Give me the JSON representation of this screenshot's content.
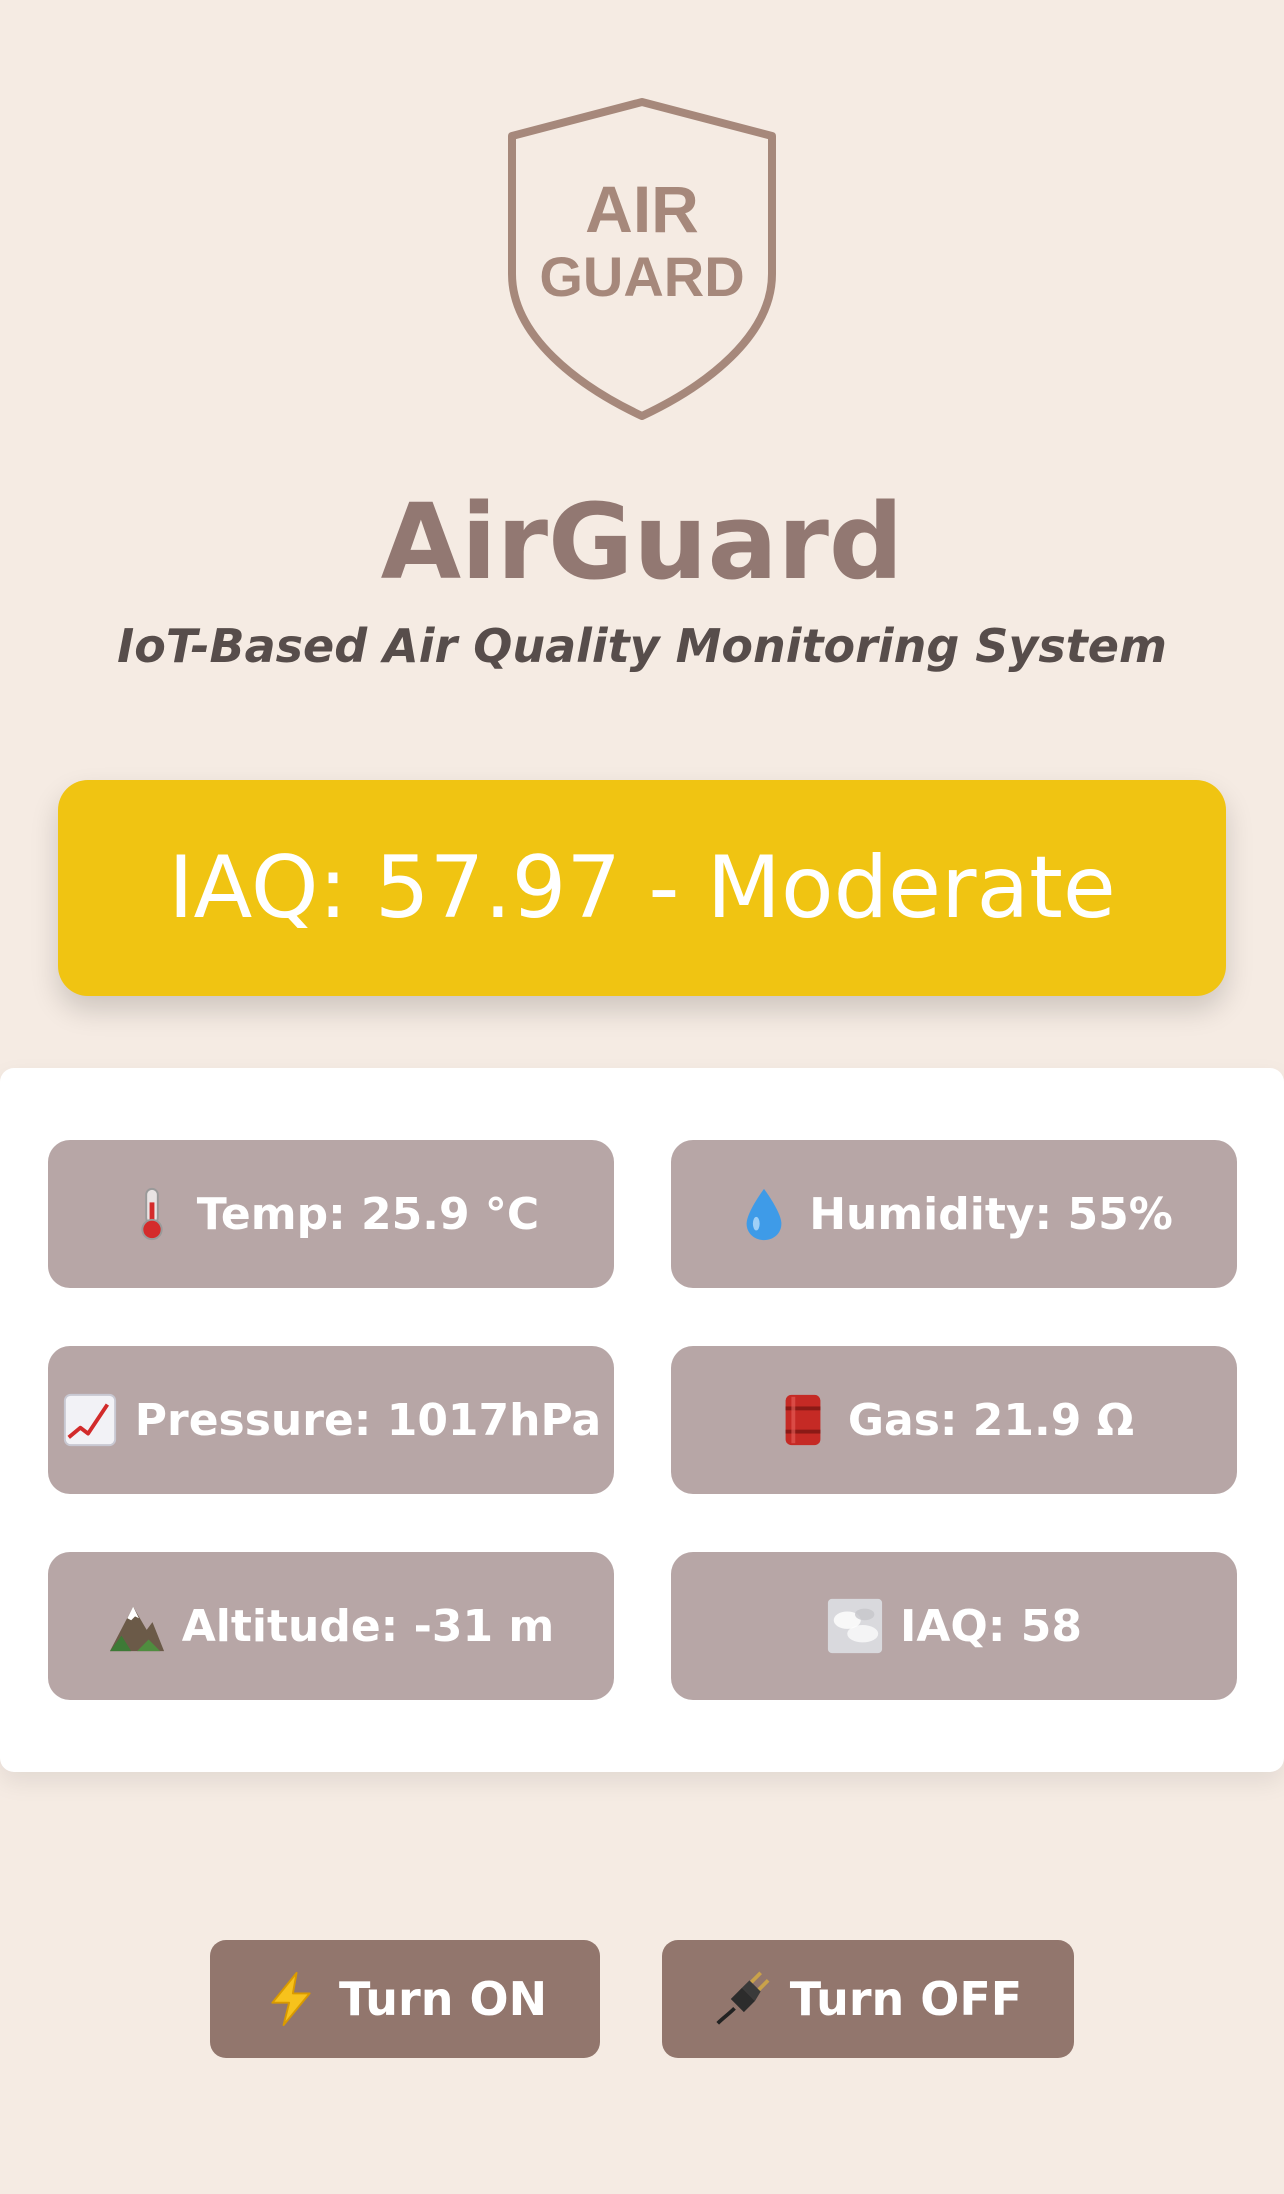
{
  "logo": {
    "line1": "AIR",
    "line2": "GUARD",
    "icon": "shield-icon"
  },
  "header": {
    "title": "AirGuard",
    "subtitle": "IoT-Based Air Quality Monitoring System"
  },
  "iaq_banner": {
    "text": "IAQ: 57.97 - Moderate",
    "color": "#f0c412"
  },
  "readings": [
    {
      "icon": "thermometer-icon",
      "label": "Temp: 25.9 °C"
    },
    {
      "icon": "droplet-icon",
      "label": "Humidity: 55%"
    },
    {
      "icon": "chart-increasing-icon",
      "label": "Pressure: 1017hPa"
    },
    {
      "icon": "oil-drum-icon",
      "label": "Gas: 21.9 Ω"
    },
    {
      "icon": "mountain-icon",
      "label": "Altitude: -31 m"
    },
    {
      "icon": "fog-icon",
      "label": "IAQ: 58"
    }
  ],
  "controls": {
    "on": {
      "icon": "lightning-icon",
      "label": "Turn ON"
    },
    "off": {
      "icon": "plug-icon",
      "label": "Turn OFF"
    }
  }
}
